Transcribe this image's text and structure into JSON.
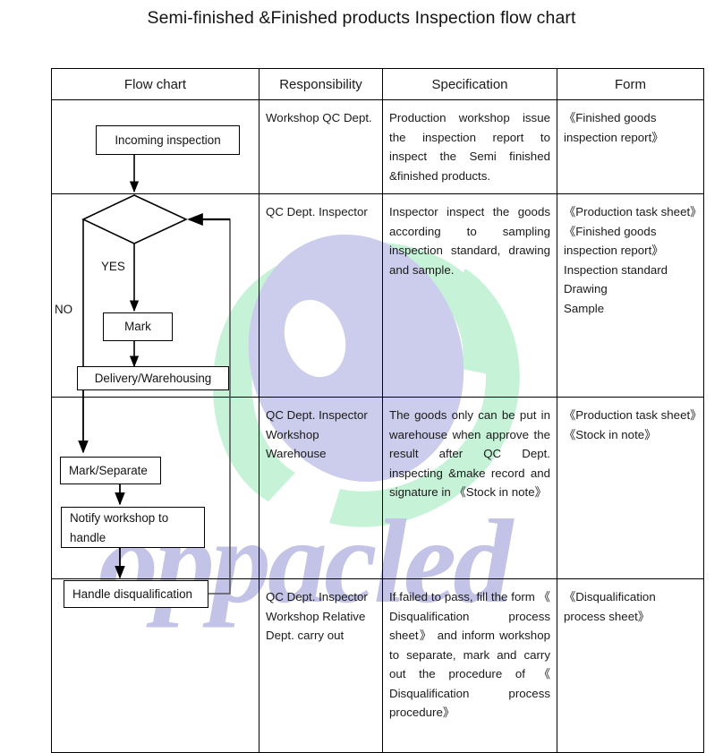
{
  "title": "Semi-finished &Finished products Inspection flow chart",
  "table": {
    "headers": [
      "Flow chart",
      "Responsibility",
      "Specification",
      "Form"
    ],
    "rows": [
      {
        "responsibility": "Workshop QC Dept.",
        "specification": "Production workshop issue the inspection report to inspect the Semi finished &finished products.",
        "form": "《Finished goods inspection report》"
      },
      {
        "responsibility": "QC Dept. Inspector",
        "specification": "Inspector inspect the goods according to sampling inspection standard, drawing and sample.",
        "form_lines": [
          "《Production task sheet》",
          "《Finished goods inspection report》",
          "Inspection standard",
          "Drawing",
          "Sample"
        ]
      },
      {
        "responsibility_lines": [
          "QC Dept. Inspector",
          "Workshop",
          "Warehouse"
        ],
        "specification": "The goods only can be put in warehouse when approve the result after QC Dept. inspecting &make record and signature in 《Stock in note》",
        "form_lines": [
          "《Production task sheet》",
          "《Stock in note》"
        ]
      },
      {
        "responsibility_lines": [
          "QC Dept. Inspector",
          "Workshop Relative",
          "Dept. carry out"
        ],
        "specification": "If failed to pass, fill the form 《 Disqualification process sheet》 and inform workshop to separate, mark and carry out the procedure of 《 Disqualification process procedure》",
        "form_lines": [
          "《Disqualification",
          "process sheet》"
        ]
      }
    ]
  },
  "flowchart": {
    "nodes": {
      "incoming_inspection": "Incoming inspection",
      "decision": "",
      "mark": "Mark",
      "delivery_warehousing": "Delivery/Warehousing",
      "mark_separate": "Mark/Separate",
      "notify_workshop_line1": "Notify workshop to",
      "notify_workshop_line2": "handle",
      "handle_disqualification": "Handle disqualification"
    },
    "branch_labels": {
      "yes": "YES",
      "no": "NO"
    }
  },
  "watermark": {
    "text": "oppacled",
    "blob_purple": "#ccccec",
    "blob_green": "#c6f2d8"
  },
  "colors": {
    "border": "#000000",
    "text": "#141414",
    "background": "#ffffff"
  }
}
